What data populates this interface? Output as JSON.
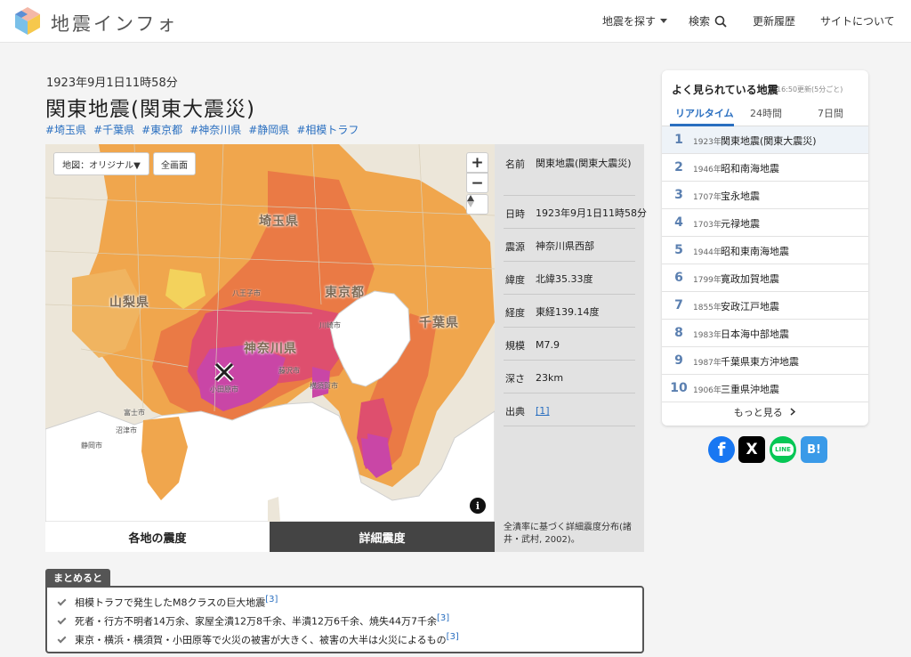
{
  "header": {
    "brand": "地震インフォ",
    "nav": {
      "search_quake": "地震を探す",
      "search": "検索",
      "history": "更新履歴",
      "about": "サイトについて"
    }
  },
  "quake": {
    "datetime": "1923年9月1日11時58分",
    "title": "関東地震(関東大震災)",
    "tags": [
      "#埼玉県",
      "#千葉県",
      "#東京都",
      "#神奈川県",
      "#静岡県",
      "#相模トラフ"
    ]
  },
  "map": {
    "map_type_button": "地図：オリジナル▼",
    "fullscreen_button": "全画面",
    "zoom_in": "+",
    "zoom_out": "−",
    "north": "▲",
    "info": "i",
    "prefectures": {
      "saitama": "埼玉県",
      "yamanashi": "山梨県",
      "tokyo": "東京都",
      "kanagawa": "神奈川県",
      "chiba": "千葉県"
    },
    "cities": {
      "hachioji": "八王子市",
      "kawasaki": "川崎市",
      "fujisawa": "藤沢市",
      "odawara": "小田原市",
      "yokosuka": "横須賀市",
      "fuji": "富士市",
      "numazu": "沼津市",
      "shizuoka": "静岡市"
    },
    "epicenter_marker": "×",
    "colors": {
      "sea": "#ffffff",
      "land": "#ece6d9",
      "intensity_low": "#f0a64d",
      "intensity_mid": "#ea7a45",
      "intensity_high": "#de4f6e",
      "intensity_max": "#c946a6"
    }
  },
  "info_panel": {
    "rows": [
      {
        "key": "名前",
        "value": "関東地震(関東大震災)"
      },
      {
        "key": "日時",
        "value": "1923年9月1日11時58分"
      },
      {
        "key": "震源",
        "value": "神奈川県西部"
      },
      {
        "key": "緯度",
        "value": "北緯35.33度"
      },
      {
        "key": "経度",
        "value": "東経139.14度"
      },
      {
        "key": "規模",
        "value": "M7.9"
      },
      {
        "key": "深さ",
        "value": "23km"
      },
      {
        "key": "出典",
        "value": "[1]"
      }
    ],
    "caption": "全潰率に基づく詳細震度分布(諸井・武村, 2002)。"
  },
  "map_tabs": {
    "regional": "各地の震度",
    "detailed": "詳細震度"
  },
  "summary": {
    "label": "まとめると",
    "items": [
      {
        "text": "相模トラフで発生したM8クラスの巨大地震",
        "ref": "[3]"
      },
      {
        "text": "死者・行方不明者14万余、家屋全潰12万8千余、半潰12万6千余、焼失44万7千余",
        "ref": "[3]"
      },
      {
        "text": "東京・横浜・横須賀・小田原等で火災の被害が大きく、被害の大半は火災によるもの",
        "ref": "[3]"
      }
    ]
  },
  "ranking": {
    "title": "よく見られている地震",
    "updated": "16:50更新(5分ごと)",
    "tabs": [
      "リアルタイム",
      "24時間",
      "7日間"
    ],
    "items": [
      {
        "rank": "1",
        "year": "1923年",
        "name": "関東地震(関東大震災)"
      },
      {
        "rank": "2",
        "year": "1946年",
        "name": "昭和南海地震"
      },
      {
        "rank": "3",
        "year": "1707年",
        "name": "宝永地震"
      },
      {
        "rank": "4",
        "year": "1703年",
        "name": "元禄地震"
      },
      {
        "rank": "5",
        "year": "1944年",
        "name": "昭和東南海地震"
      },
      {
        "rank": "6",
        "year": "1799年",
        "name": "寛政加賀地震"
      },
      {
        "rank": "7",
        "year": "1855年",
        "name": "安政江戸地震"
      },
      {
        "rank": "8",
        "year": "1983年",
        "name": "日本海中部地震"
      },
      {
        "rank": "9",
        "year": "1987年",
        "name": "千葉県東方沖地震"
      },
      {
        "rank": "10",
        "year": "1906年",
        "name": "三重県沖地震"
      }
    ],
    "more": "もっと見る"
  },
  "share": {
    "facebook": "f",
    "x": "X",
    "line": "LINE",
    "hatena": "B!",
    "colors": {
      "facebook": "#1877f2",
      "x": "#000000",
      "line": "#06c755",
      "hatena": "#3a9ae8"
    }
  }
}
